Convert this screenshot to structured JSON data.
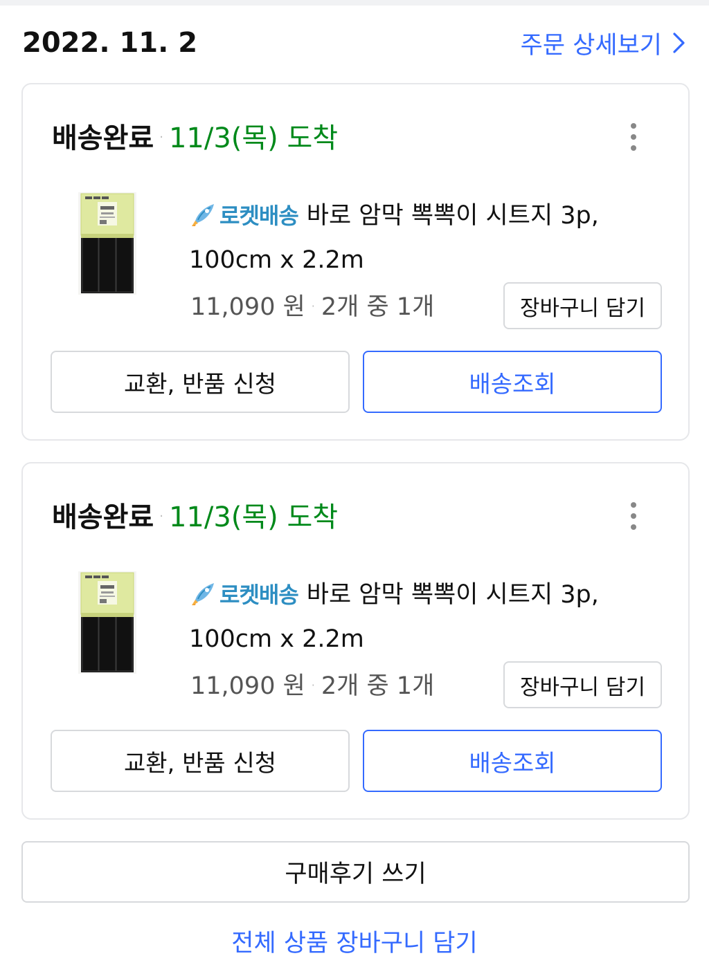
{
  "order": {
    "date": "2022. 11. 2",
    "detail_link": "주문 상세보기"
  },
  "colors": {
    "accent": "#346aff",
    "arrival_green": "#00891a",
    "rocket_blue": "#2d8ec2"
  },
  "cards": [
    {
      "status": "배송완료",
      "separator": "·",
      "arrival": "11/3(목) 도착",
      "rocket_label": "로켓배송",
      "product_title_line1": "바로 암막 뽁뽁이 시트지 3p,",
      "product_title_line2": "100cm x 2.2m",
      "price": "11,090 원",
      "quantity": "2개 중 1개",
      "cart_button": "장바구니 담기",
      "exchange_button": "교환, 반품 신청",
      "track_button": "배송조회"
    },
    {
      "status": "배송완료",
      "separator": "·",
      "arrival": "11/3(목) 도착",
      "rocket_label": "로켓배송",
      "product_title_line1": "바로 암막 뽁뽁이 시트지 3p,",
      "product_title_line2": "100cm x 2.2m",
      "price": "11,090 원",
      "quantity": "2개 중 1개",
      "cart_button": "장바구니 담기",
      "exchange_button": "교환, 반품 신청",
      "track_button": "배송조회"
    }
  ],
  "footer": {
    "review_button": "구매후기 쓰기",
    "all_cart_link": "전체 상품 장바구니 담기"
  }
}
